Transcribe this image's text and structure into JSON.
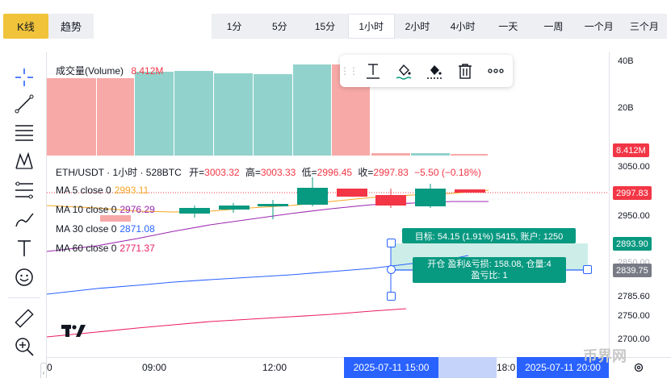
{
  "tabs": {
    "kline": "K线",
    "trend": "趋势"
  },
  "intervals": [
    "1分",
    "5分",
    "15分",
    "1小时",
    "2小时",
    "4小时",
    "一天",
    "一周",
    "一个月",
    "三个月"
  ],
  "active_interval": "1小时",
  "volume_legend": {
    "label": "成交量(Volume)",
    "value": "8.412M"
  },
  "symbol_legend": {
    "title": "ETH/USDT · 1小时 · 528BTC",
    "open_label": "开=",
    "open": "3003.32",
    "high_label": "高=",
    "high": "3003.33",
    "low_label": "低=",
    "low": "2996.45",
    "close_label": "收=",
    "close": "2997.83",
    "change": "−5.50 (−0.18%)"
  },
  "ma_legends": [
    {
      "label": "MA 5 close 0",
      "value": "2993.11",
      "color": "#f5a623"
    },
    {
      "label": "MA 10 close 0",
      "value": "2976.29",
      "color": "#9c27b0"
    },
    {
      "label": "MA 30 close 0",
      "value": "2871.08",
      "color": "#2962ff"
    },
    {
      "label": "MA 60 close 0",
      "value": "2771.37",
      "color": "#e91e63"
    }
  ],
  "price_axis": {
    "volume_ticks": [
      "40B",
      "20B"
    ],
    "price_ticks": [
      "3050.00",
      "2950.00",
      "2785.60",
      "2750.00",
      "2700.00"
    ],
    "volume_tag": "8.412M",
    "last_price_tag": "2997.83",
    "target_tag": "2893.90",
    "entry_tag": "2839.75",
    "hidden_tick": "2850.00"
  },
  "time_axis": {
    "labels": [
      "0",
      "09:00",
      "12:00",
      "18:0"
    ],
    "highlight_start": "2025-07-11   15:00",
    "highlight_end": "2025-07-11   20:00"
  },
  "position": {
    "target_text": "目标: 54.15 (1.91%) 5415, 账户: 1250",
    "open_line1": "开仓 盈利&亏损: 158.08, 仓量:4",
    "open_line2": "盈亏比: 1"
  },
  "watermark": "币界网",
  "colors": {
    "up": "#089981",
    "down": "#f23645",
    "accent": "#2962ff",
    "kline_tab": "#f0c33a"
  },
  "icons": {
    "left_toolbar": [
      "crosshair-icon",
      "trend-line-icon",
      "horizontal-lines-icon",
      "pattern-icon",
      "fib-icon",
      "brush-icon",
      "text-icon",
      "emoji-icon",
      "ruler-icon",
      "zoom-in-icon"
    ],
    "draw_toolbar": [
      "text-icon",
      "fill-color-icon",
      "border-color-icon",
      "delete-icon",
      "more-icon"
    ]
  }
}
